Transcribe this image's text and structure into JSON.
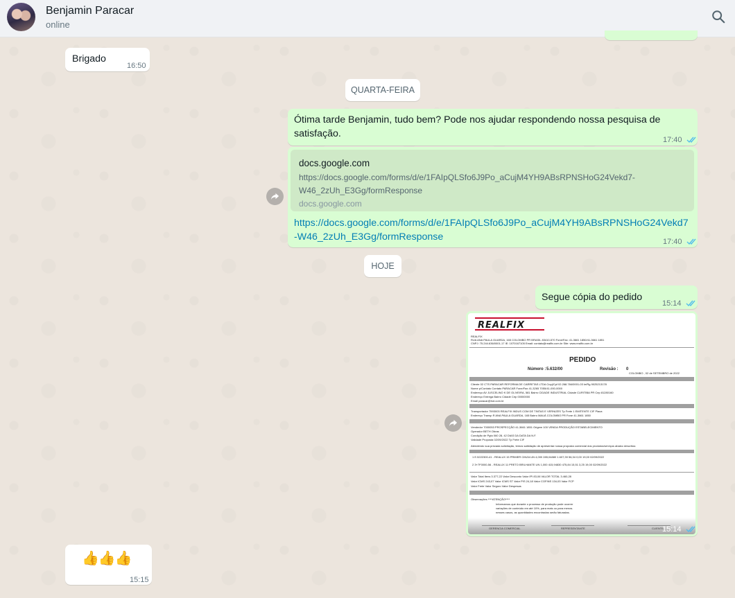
{
  "header": {
    "contact_name": "Benjamin Paracar",
    "status": "online",
    "icons": {
      "search": "search-icon"
    }
  },
  "colors": {
    "incoming_bubble": "#ffffff",
    "outgoing_bubble": "#d9fdd3",
    "read_ticks": "#53bdeb",
    "link": "#027eb5"
  },
  "messages": {
    "brigado": {
      "text": "Brigado",
      "time": "16:50"
    },
    "day_wed": "QUARTA-FEIRA",
    "survey": {
      "text": "Ótima tarde Benjamin, tudo bem? Pode nos ajudar respondendo nossa pesquisa de satisfação.",
      "time": "17:40"
    },
    "link_msg": {
      "preview_title": "docs.google.com",
      "preview_desc": "https://docs.google.com/forms/d/e/1FAIpQLSfo6J9Po_aCujM4YH9ABsRPNSHoG24Vekd7-W46_2zUh_E3Gg/formResponse",
      "preview_domain": "docs.google.com",
      "url": "https://docs.google.com/forms/d/e/1FAIpQLSfo6J9Po_aCujM4YH9ABsRPNSHoG24Vekd7-W46_2zUh_E3Gg/formResponse",
      "time": "17:40"
    },
    "day_today": "HOJE",
    "order_msg": {
      "text": "Segue cópia do pedido",
      "time": "15:14"
    },
    "image_msg": {
      "time": "15:14",
      "doc": {
        "logo": "REALFIX",
        "title": "PEDIDO",
        "numero_label": "Número :",
        "numero_value": "5.632/00",
        "revisao_label": "Revisão :",
        "revisao_value": "0",
        "date_line": "COLOMBO , 02 de SETEMBRO de 2022",
        "company_line": "REALFIX",
        "address_line": "RUA ANA PAULA GUARDA, 165     COLOMBO     PR  BRASIL     83410-570     Fone/Fax: 41-3661 1850/41-3661 1851",
        "cnpj_line": "CNPJ: 75.244.636/0001-17     IE: 1070167105     Email: contato@realfix.com.br     Site: www.realfix.com.br",
        "section_client": "Dados do Cliente",
        "section_transport": "Dados do Transportador",
        "section_negotiation": "Dados da Negociação",
        "section_obs": "Observações",
        "client_lines": [
          "Cliente        02 CTS PARACAR REFORMA DE CARRETAS LTDA                      Cnpj/Cpf   02.268.784/0001-03      Ie/Rg   9025213178",
          "Nome p/Contato                            Contato   PARACAR                 Fone/Fax   41-3265 7055/41-000-0000",
          "Endereço       AV JUSCELINO K DE OLIVEIRA, 581     Bairro   CIDADE INDUSTRIAL   Cidade   CURITIBA   PR     Cep   81280160",
          "Endereço Entrega                          Bairro                  Cidade                Cep   00000000",
          "Email          paracar@hot.com.br"
        ],
        "transport_lines": [
          "Transportador  7593003 REALFIX INDUS COM DE TINTAS E VERNIZES      Tp Frete   1 EMITENTE CIF      Placa",
          "Endereço Transp  R ANA PAULA GUARDA, 165     Bairro   MAUÁ     COLOMBO   PR     Fone   41-3661 1850"
        ],
        "negotiation_lines": [
          "Vendedor       7000053 PROSPECÇÃO                   41-3661 1851      Origem   100 VENDA PRODUÇÃO ESTABELECIMENTO",
          "Operador       BETH                                                   Obras",
          "Condição de Pgto  060 28, 42 DIAS DA DATA DA N.F.",
          "Validade Proposta  02/09/2022                                         Tp Frete   CIF"
        ],
        "attending_line": "Atendendo sua prezada solicitação, temos satisfação de apresentar nossa proposta comercial dos produtos/serviços abaixo descritos:",
        "items": [
          "1  E.5222300-41 - REALUX 15 PRIMER CINZA   UN   4,000   285,04880   1.607,39   56,34   0,00   19,00   02/09/2022",
          "2  3+7F0000-56 - REALUX 11 PRETO BRILHANTE   UN   1,000   415,94830   475,84   15,51   3,25   19,00   02/09/2022"
        ],
        "totals_lines": [
          "Valor Total Itens  3.377,22     Valor Desconto         Valor IPI  83,06           VALOR TOTAL  3.460,28",
          "Valor ICMS  243,07     Valor ICMS ST          Valor PIS  24,18     Valor COFINS  134,03     Valor FCP",
          "Valor Frete        Valor Seguro           Valor Despesas"
        ],
        "obs_lines": [
          "Observações   ****ATENÇÃO****",
          "Informamos que durante o processo de produção pode ocorrer",
          "variações de conteúdo em até 10%, para mais ou para menos.",
          "nesses casos, as quantidades encontradas serão faturadas."
        ],
        "footer_labels": [
          "GERENCIA COMERCIAL",
          "REPRESENTANTE",
          "CLIENTE"
        ]
      }
    },
    "thumbs": {
      "text": "👍👍👍",
      "time": "15:15"
    }
  }
}
